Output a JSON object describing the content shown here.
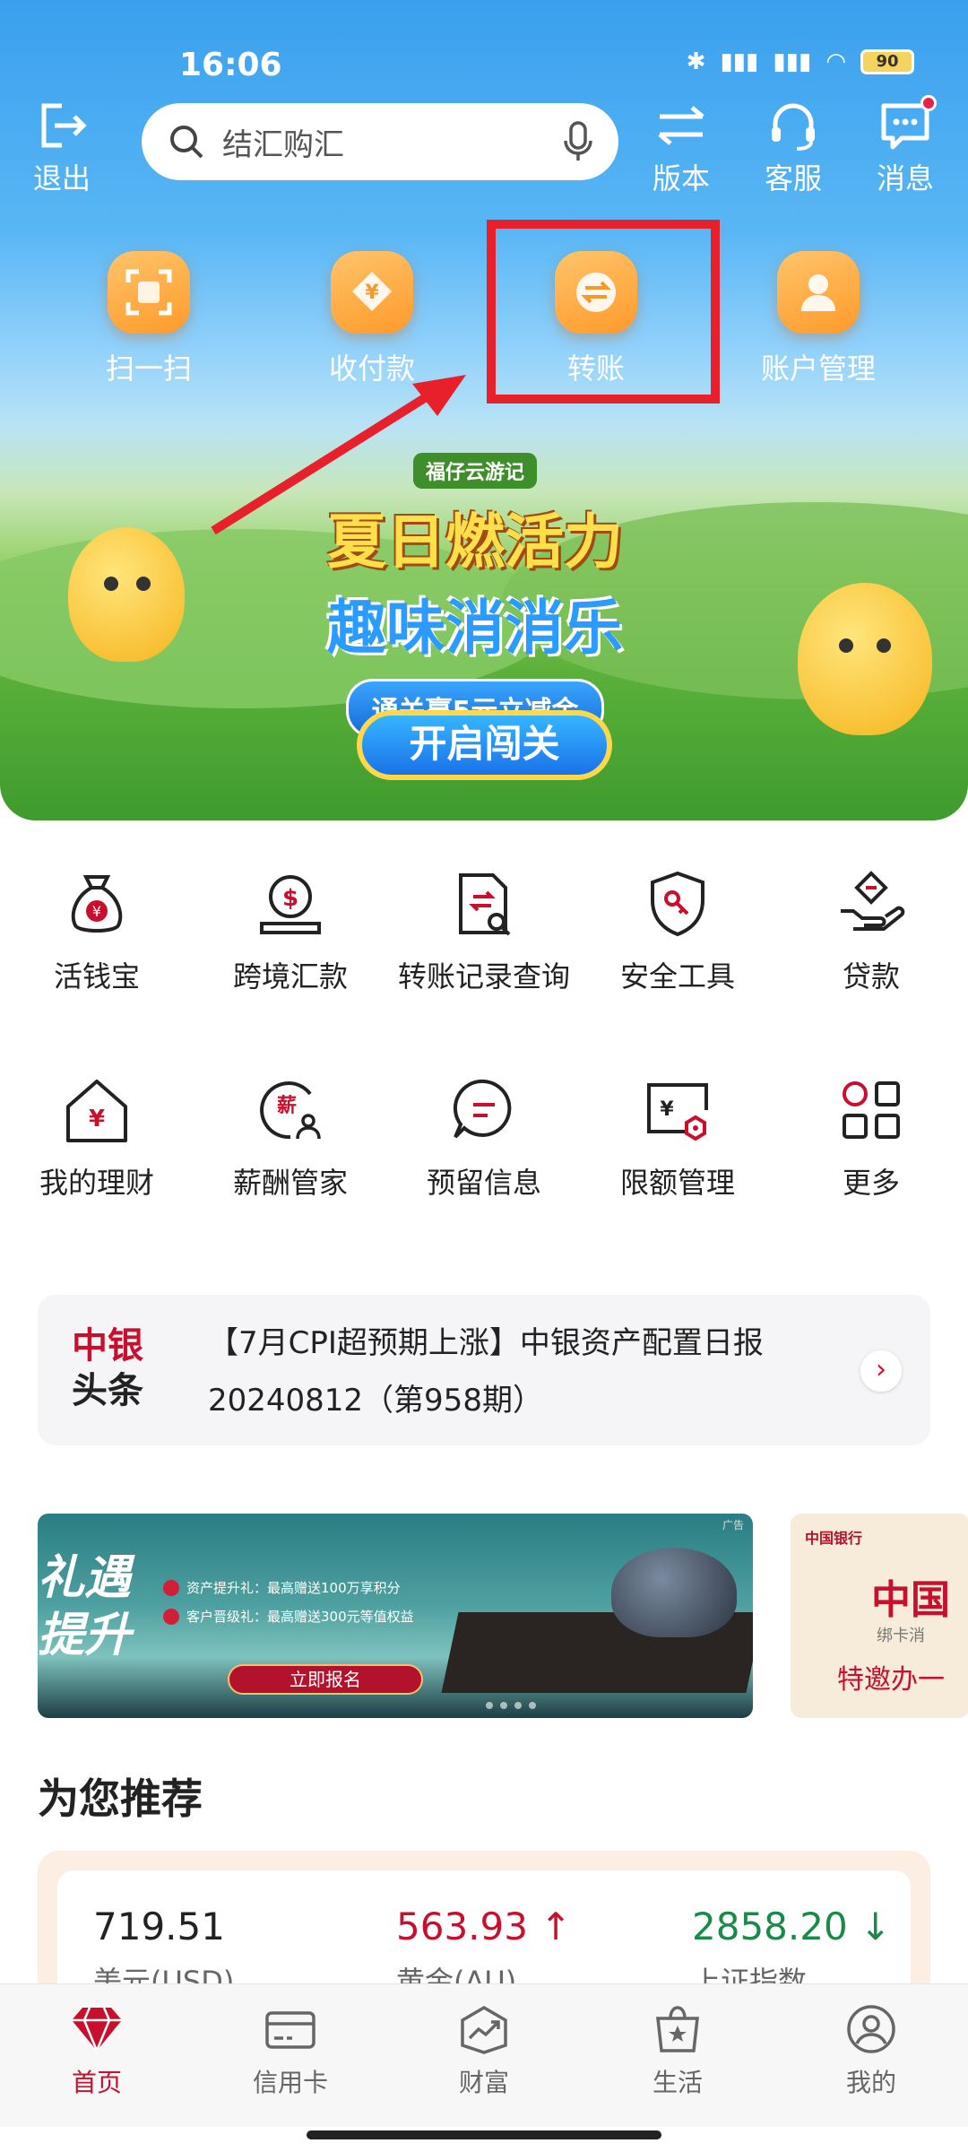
{
  "status": {
    "time": "16:06",
    "battery": "90"
  },
  "topbar": {
    "logout_label": "退出",
    "search_placeholder": "结汇购汇",
    "version_label": "版本",
    "service_label": "客服",
    "messages_label": "消息"
  },
  "quick_actions": [
    {
      "label": "扫一扫",
      "icon": "scan-icon"
    },
    {
      "label": "收付款",
      "icon": "payment-icon"
    },
    {
      "label": "转账",
      "icon": "transfer-icon"
    },
    {
      "label": "账户管理",
      "icon": "account-icon"
    }
  ],
  "banner": {
    "small_title": "福仔云游记",
    "line1": "夏日燃活力",
    "line2": "趣味消消乐",
    "pill": "通关赢5元立减金",
    "cta": "开启闯关"
  },
  "grid": [
    {
      "label": "活钱宝",
      "icon": "money-bag-icon"
    },
    {
      "label": "跨境汇款",
      "icon": "cross-border-remit-icon"
    },
    {
      "label": "转账记录查询",
      "icon": "transfer-record-icon"
    },
    {
      "label": "安全工具",
      "icon": "shield-key-icon"
    },
    {
      "label": "贷款",
      "icon": "loan-icon"
    },
    {
      "label": "我的理财",
      "icon": "house-yen-icon"
    },
    {
      "label": "薪酬管家",
      "icon": "salary-icon"
    },
    {
      "label": "预留信息",
      "icon": "chat-info-icon"
    },
    {
      "label": "限额管理",
      "icon": "limit-icon"
    },
    {
      "label": "更多",
      "icon": "more-grid-icon"
    }
  ],
  "news": {
    "logo_line1": "中银",
    "logo_line2": "头条",
    "text": "【7月CPI超预期上涨】中银资产配置日报20240812（第958期）"
  },
  "ads": {
    "ad1_big": "礼遇\n提升",
    "ad1_row1": "资产提升礼：最高赠送100万享积分",
    "ad1_row2": "客户晋级礼：最高赠送300元等值权益",
    "ad1_button": "立即报名",
    "ad1_tag": "广告",
    "ad2_logo": "中国银行",
    "ad2_big": "中国",
    "ad2_small": "绑卡消",
    "ad2_text": "特邀办一"
  },
  "recommend": {
    "title": "为您推荐",
    "rates": [
      {
        "value": "719.51",
        "label": "美元(USD)",
        "color": "#222222",
        "trend": ""
      },
      {
        "value": "563.93",
        "label": "黄金(AU)",
        "color": "#c8102e",
        "trend": "↑"
      },
      {
        "value": "2858.20",
        "label": "上证指数",
        "color": "#1a8a4a",
        "trend": "↓"
      }
    ]
  },
  "bottom_nav": [
    {
      "label": "首页",
      "icon": "diamond-home-icon",
      "active": true
    },
    {
      "label": "信用卡",
      "icon": "credit-card-icon",
      "active": false
    },
    {
      "label": "财富",
      "icon": "wealth-chart-icon",
      "active": false
    },
    {
      "label": "生活",
      "icon": "shopping-bag-icon",
      "active": false
    },
    {
      "label": "我的",
      "icon": "profile-icon",
      "active": false
    }
  ],
  "colors": {
    "brand_red": "#c8102e",
    "highlight_box": "#e8202c",
    "gold_up": "#c8102e",
    "index_down": "#1a8a4a"
  }
}
